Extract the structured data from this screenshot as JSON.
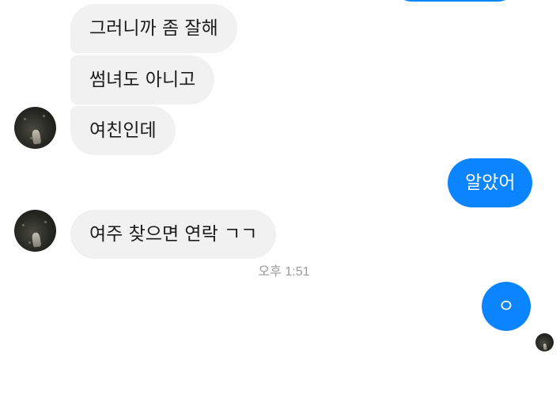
{
  "messages": [
    {
      "text": "그러니까 좀 잘해"
    },
    {
      "text": "썸녀도 아니고"
    },
    {
      "text": "여친인데"
    },
    {
      "text": "알았어"
    },
    {
      "text": "여주 찾으면 연락 ㄱㄱ"
    },
    {
      "text": "ㅇ"
    }
  ],
  "timestamp": "오후 1:51",
  "colors": {
    "sent_bubble": "#0a84ff",
    "received_bubble": "#f1f1f1"
  },
  "icons": {
    "contact_avatar": "dark-photo-avatar",
    "seen_indicator": "small-avatar-read-receipt"
  }
}
